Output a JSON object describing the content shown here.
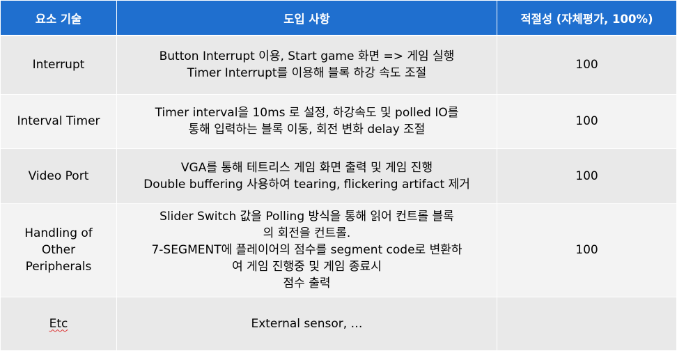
{
  "table": {
    "headers": {
      "component": "요소 기술",
      "details": "도입 사항",
      "score": "적절성 (자체평가, 100%)"
    },
    "rows": [
      {
        "component": "Interrupt",
        "details": [
          "Button Interrupt 이용, Start game 화면 => 게임 실행",
          "Timer Interrupt를 이용해 블록 하강 속도 조절"
        ],
        "score": "100"
      },
      {
        "component": "Interval Timer",
        "details": [
          "Timer interval을 10ms 로 설정, 하강속도 및 polled IO를",
          "통해 입력하는 블록 이동, 회전 변화 delay 조절"
        ],
        "score": "100"
      },
      {
        "component": "Video Port",
        "details": [
          "VGA를 통해 테트리스 게임 화면 출력 및 게임 진행",
          "Double buffering 사용하여 tearing, flickering artifact 제거"
        ],
        "score": "100"
      },
      {
        "component": "Handling of Other Peripherals",
        "component_lines": [
          "Handling of",
          "Other",
          "Peripherals"
        ],
        "details": [
          "Slider Switch 값을 Polling 방식을 통해 읽어 컨트롤 블록",
          "의 회전을 컨트롤.",
          "7-SEGMENT에 플레이어의 점수를 segment code로 변환하",
          "여 게임 진행중 및 게임 종료시",
          "점수 출력"
        ],
        "score": "100"
      },
      {
        "component": "Etc",
        "details": [
          "External sensor, …"
        ],
        "score": ""
      }
    ]
  }
}
